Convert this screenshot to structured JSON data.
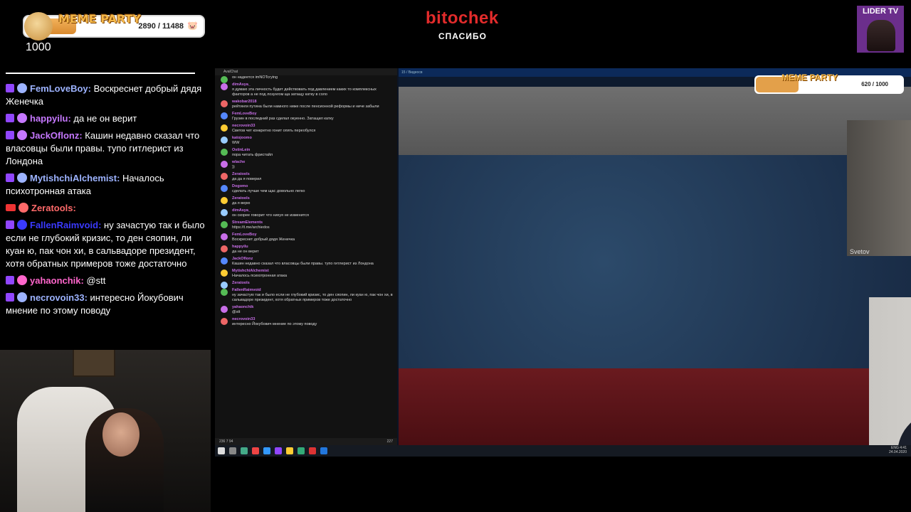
{
  "overlay": {
    "meme_title": "MEME PARTY",
    "meme_count": "2890 / 11488",
    "meme_icon": "pig-icon",
    "counter_below": "1000",
    "logo_main": "bitochek",
    "logo_sub": "СПАСИБО",
    "badge": "LIDER TV"
  },
  "left_chat": [
    {
      "platform": "twitch",
      "user": "FemLoveBoy:",
      "text": " Воскреснет добрый дядя Женечка",
      "color": "#9db3ff"
    },
    {
      "platform": "twitch",
      "user": "happyilu:",
      "text": " да не он верит",
      "color": "#c678ff"
    },
    {
      "platform": "twitch",
      "user": "JackOflonz:",
      "text": " Кашин недавно сказал что власовцы были правы. тупо гитлерист из Лондона",
      "color": "#c678ff"
    },
    {
      "platform": "twitch",
      "user": "MytishchiAlchemist:",
      "text": " Началось психотронная атака",
      "color": "#9db3ff"
    },
    {
      "platform": "live",
      "user": "Zeratools:",
      "text": "",
      "color": "#ff6a6a"
    },
    {
      "platform": "twitch",
      "user": "FallenRaimvoid:",
      "text": " ну зачастую так и было если не глубокий кризис, то ден сяопин, ли куан ю, пак чон хи, в сальвадоре президент, хотя обратных примеров тоже достаточно",
      "color": "#3a3aff"
    },
    {
      "platform": "twitch",
      "user": "yahaonchik:",
      "text": " @stt",
      "color": "#ff66cc"
    },
    {
      "platform": "twitch",
      "user": "necrovoin33:",
      "text": " интересно Йокубович мнение по этому поводу",
      "color": "#9db3ff"
    }
  ],
  "chat_window": {
    "title": "AvalChat",
    "messages": [
      {
        "user": "",
        "text": "он надеется imNOTcrying"
      },
      {
        "user": "dimAsya_",
        "text": "я думаю эта личность будет действовать под давлением каких то комплексных факторов а не под лозунгом ща затащу катку в соло"
      },
      {
        "user": "wakobar2018",
        "text": "рейтинги путина были намного ниже после пенсионной реформы и ниче забыли"
      },
      {
        "user": "FemLoveBoy",
        "text": "Грузин в последний раз сделал окуенно. Затащил катку"
      },
      {
        "user": "necrovoin33",
        "text": "Светов чет конкретно гонит опять переобулся"
      },
      {
        "user": "katojoomo",
        "text": "WW"
      },
      {
        "user": "OstinLein",
        "text": "пора читать фристайл"
      },
      {
        "user": "wlache",
        "text": "))"
      },
      {
        "user": "Zeratools",
        "text": "да да я поверил"
      },
      {
        "user": "Dogomo",
        "text": "сделать лучше чем щас довольно легко"
      },
      {
        "user": "Zeratools",
        "text": "да я верю"
      },
      {
        "user": "dimAsya_",
        "text": "он скорее говорит что нихуя не изменится"
      },
      {
        "user": "StreamElements",
        "text": "https://t.me/archiedos"
      },
      {
        "user": "FemLoveBoy",
        "text": "Воскреснет добрый дядя Женечка"
      },
      {
        "user": "happyilu",
        "text": "да не он верит"
      },
      {
        "user": "JackOflonz",
        "text": "Кашин недавно сказал что власовцы были правы. тупо гитлерист из Лондона"
      },
      {
        "user": "MytishchiAlchemist",
        "text": "Началось психотронная атака"
      },
      {
        "user": "Zeratools",
        "text": ""
      },
      {
        "user": "FallenRaimvoid",
        "text": "ну зачастую так и было если не глубокий кризис, то ден сяопин, ли куан ю, пак чон хи, в сальвадоре президент, хотя обратных примеров тоже достаточно"
      },
      {
        "user": "yahaonchik",
        "text": "@stt"
      },
      {
        "user": "necrovoin33",
        "text": "интересно Йокубович мнение по этому поводу"
      }
    ],
    "footer": "236  7  94",
    "viewer_count": "227"
  },
  "video": {
    "window_title": "15 / Видеосв",
    "mini_meme_title": "MEME PARTY",
    "mini_meme_count": "620 / 1000",
    "top_cam_label": "Svetov"
  },
  "taskbar": {
    "clock_time": "4:41",
    "clock_date": "24.04.2020",
    "lang": "ENG"
  },
  "colors": {
    "accent_red": "#e22b2b",
    "twitch_purple": "#9146ff",
    "flag_red": "#6a1a1f",
    "flag_blue": "#2c4a6a"
  }
}
